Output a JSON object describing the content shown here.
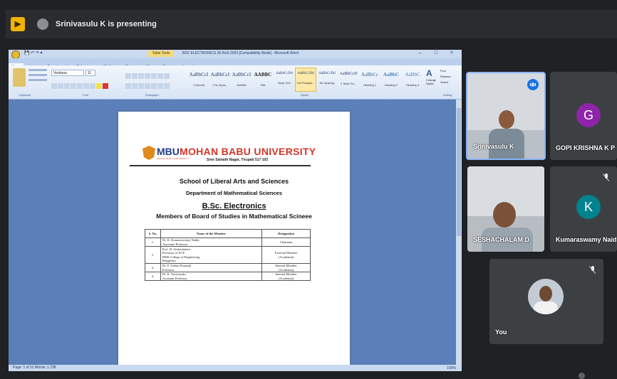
{
  "meeting": {
    "app_icon": "google-meet-icon",
    "presenting_text": "Srinivasulu K is presenting"
  },
  "word": {
    "title_tools": "Table Tools",
    "document_title": "BSC ELECTRONICS 2K BoS 2023 [Compatibility Mode] - Microsoft Word",
    "window_controls": "– □ ×",
    "tabs": [
      "Home",
      "Insert",
      "Page Layout",
      "References",
      "Mailings",
      "Review",
      "View",
      "Design",
      "Layout"
    ],
    "font_name": "Verdana",
    "font_size": "11",
    "groups": [
      "Clipboard",
      "Font",
      "Paragraph",
      "Styles",
      "Editing"
    ],
    "styles": [
      {
        "sample": "AaBbCcI",
        "name": "1 Normal"
      },
      {
        "sample": "AaBbCcI",
        "name": "1 No Spac..."
      },
      {
        "sample": "AaBbCcI",
        "name": "Subtitle"
      },
      {
        "sample": "AABBC",
        "name": "Title"
      },
      {
        "sample": "AaBbCcDd",
        "name": "Body Text"
      },
      {
        "sample": "AaBbCcDd",
        "name": "List Paragra..."
      },
      {
        "sample": "AaBbCcDd",
        "name": "No Spacing"
      },
      {
        "sample": "AaBbCcD",
        "name": "1 Table Pa..."
      },
      {
        "sample": "AaBbCc",
        "name": "Heading 1"
      },
      {
        "sample": "AaBbC",
        "name": "Heading 2"
      },
      {
        "sample": "AaBbC",
        "name": "Heading 3"
      }
    ],
    "change_styles": "Change Styles",
    "editing": [
      "Find",
      "Replace",
      "Select"
    ],
    "status_left": "Page: 1 of 11   Words: 1,738",
    "status_zoom": "100%"
  },
  "document": {
    "logo_text": "MBU",
    "logo_sub": "MOHAN BABU UNIVERSITY",
    "university": "MOHAN BABU UNIVERSITY",
    "address": "Sree Sainath Nagar, Tirupati 517 102",
    "school": "School of Liberal Arts and Sciences",
    "department": "Department of Mathematical Sciences",
    "program": "B.Sc. Electronics",
    "members_title": "Members of Board of Studies in Mathematical Scineee",
    "table": {
      "headers": [
        "S. No.",
        "Name of the Member",
        "Designation"
      ],
      "rows": [
        {
          "sno": "1.",
          "member": [
            "Dr. K. Kumaraswamy Naidu",
            "Associate Professor"
          ],
          "designation": [
            "Chairman"
          ]
        },
        {
          "sno": "2.",
          "member": [
            "Prof. D. Seshachalam",
            "Professor of ECE",
            "BMS College of Engineering",
            "Bengaluru"
          ],
          "designation": [
            "External Member",
            "(Academia)"
          ]
        },
        {
          "sno": "3.",
          "member": [
            "Dr. P. Vishnu Prasanth",
            "Professor"
          ],
          "designation": [
            "Internal Member",
            "(Academia)"
          ]
        },
        {
          "sno": "4.",
          "member": [
            "Dr. K. Srinivasulu",
            "Assistant Professor"
          ],
          "designation": [
            "Internal Member",
            "(Academia)"
          ]
        }
      ]
    }
  },
  "participants": [
    {
      "name": "Srinivasulu K",
      "type": "video",
      "speaking": true
    },
    {
      "name": "GOPI KRISHNA K P",
      "initial": "G",
      "color": "#8e24aa"
    },
    {
      "name": "SESHACHALAM D",
      "type": "video"
    },
    {
      "name": "Kumaraswamy Naidu K",
      "initial": "K",
      "color": "#00838f",
      "muted": true
    },
    {
      "name": "You",
      "type": "video",
      "muted": true
    }
  ]
}
